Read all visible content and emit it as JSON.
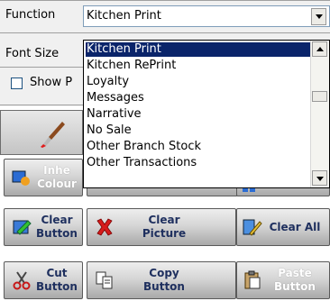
{
  "props": {
    "function_label": "Function",
    "function_value": "Kitchen Print",
    "font_size_label": "Font Size",
    "show_label": "Show P"
  },
  "dropdown": {
    "items": [
      "Kitchen Print",
      "Kitchen RePrint",
      "Loyalty",
      "Messages",
      "Narrative",
      "No Sale",
      "Other Branch Stock",
      "Other Transactions"
    ],
    "selected_index": 0
  },
  "buttons": {
    "inherit_colour": [
      "Inhe",
      "Colour"
    ],
    "colour": [
      "Colour"
    ],
    "clear_button": [
      "Clear",
      "Button"
    ],
    "clear_picture": [
      "Clear",
      "Picture"
    ],
    "clear_all": "Clear All",
    "cut_button": [
      "Cut",
      "Button"
    ],
    "copy_button": [
      "Copy",
      "Button"
    ],
    "paste_button": [
      "Paste",
      "Button"
    ]
  },
  "colors": {
    "selection": "#0a246a",
    "button_text": "#1e2f5e"
  }
}
